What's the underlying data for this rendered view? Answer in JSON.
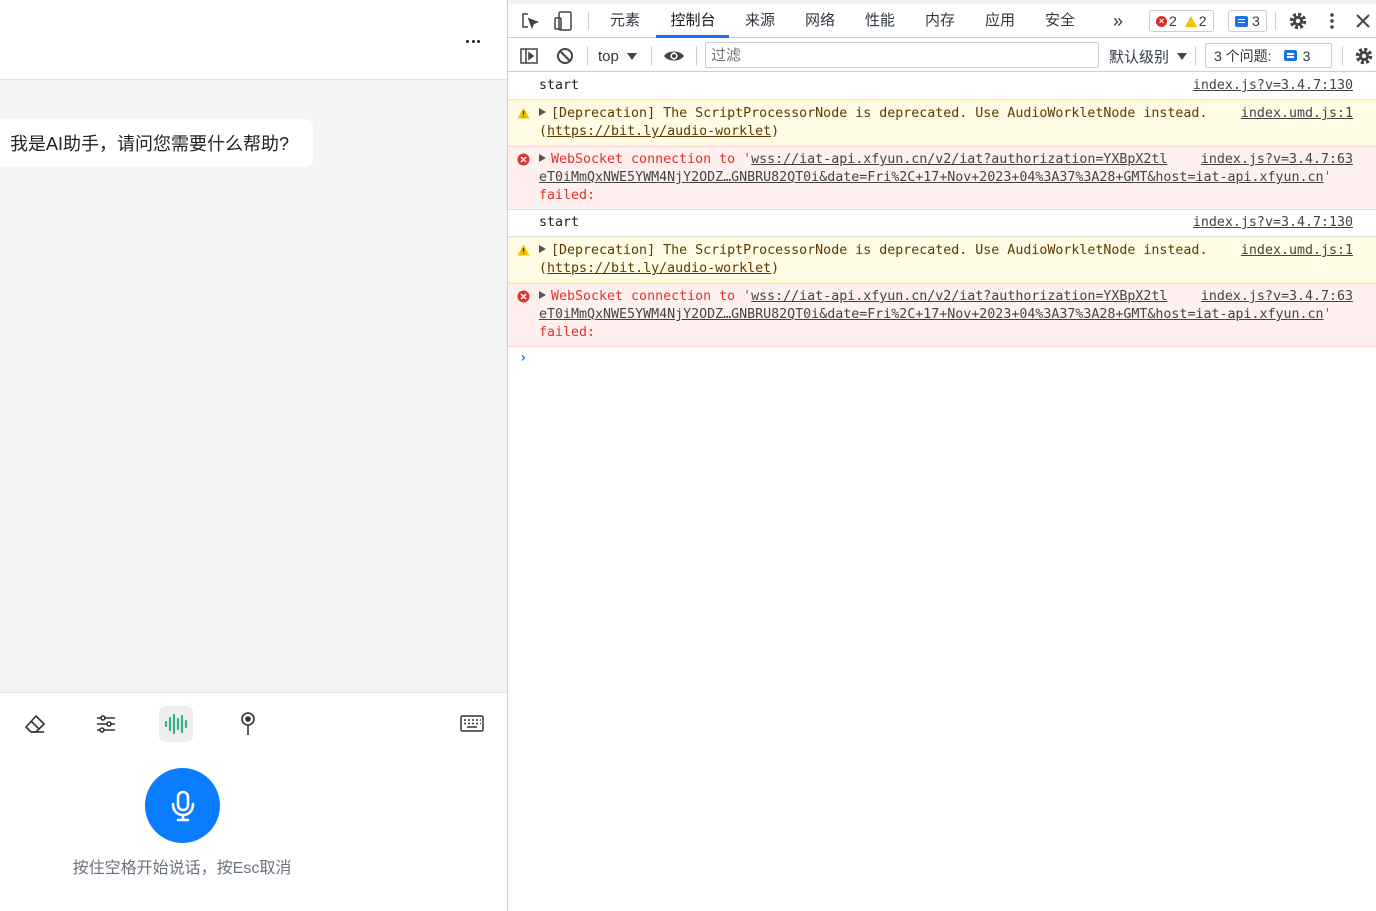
{
  "chat": {
    "header": {
      "more_label": "⋯"
    },
    "bubble_text": "我是AI助手，请问您需要什么帮助?",
    "footer": {
      "tools": [
        "eraser-icon",
        "sliders-icon",
        "voice-wave-icon",
        "pin-icon",
        "keyboard-icon"
      ],
      "active_tool": "voice-wave-icon",
      "hint": "按住空格开始说话，按Esc取消"
    },
    "colors": {
      "accent": "#0a7cff",
      "voice_active": "#36b37e"
    }
  },
  "devtools": {
    "tabs": [
      "元素",
      "控制台",
      "来源",
      "网络",
      "性能",
      "内存",
      "应用",
      "安全"
    ],
    "active_tab": "控制台",
    "more_tabs": "»",
    "error_count": "2",
    "warning_count": "2",
    "message_count": "3",
    "toolbar": {
      "context": "top",
      "filter_placeholder": "过滤",
      "level": "默认级别",
      "issues_label": "3 个问题:",
      "issues_count": "3"
    },
    "logs": [
      {
        "level": "info",
        "text": "start",
        "source": "index.js?v=3.4.7:130"
      },
      {
        "level": "warning",
        "text": "[Deprecation] The ScriptProcessorNode is deprecated. Use AudioWorkletNode instead.",
        "link": "https://bit.ly/audio-worklet",
        "source": "index.umd.js:1"
      },
      {
        "level": "error",
        "prefix": "WebSocket connection to '",
        "url1": "wss://iat-api.xfyun.cn/v2/iat?authorization=YXBpX2tl",
        "url2": "eT0iMmQxNWE5YWM4NjY2ODZ…GNBRU82QT0i&date=Fri%2C+17+Nov+2023+04%3A37%3A28+GMT&host=iat-api.xfyun.cn",
        "suffix": "'",
        "failed": "failed:",
        "source": "index.js?v=3.4.7:63"
      },
      {
        "level": "info",
        "text": "start",
        "source": "index.js?v=3.4.7:130"
      },
      {
        "level": "warning",
        "text": "[Deprecation] The ScriptProcessorNode is deprecated. Use AudioWorkletNode instead.",
        "link": "https://bit.ly/audio-worklet",
        "source": "index.umd.js:1"
      },
      {
        "level": "error",
        "prefix": "WebSocket connection to '",
        "url1": "wss://iat-api.xfyun.cn/v2/iat?authorization=YXBpX2tl",
        "url2": "eT0iMmQxNWE5YWM4NjY2ODZ…GNBRU82QT0i&date=Fri%2C+17+Nov+2023+04%3A37%3A28+GMT&host=iat-api.xfyun.cn",
        "suffix": "'",
        "failed": "failed:",
        "source": "index.js?v=3.4.7:63"
      }
    ],
    "prompt": "›"
  }
}
